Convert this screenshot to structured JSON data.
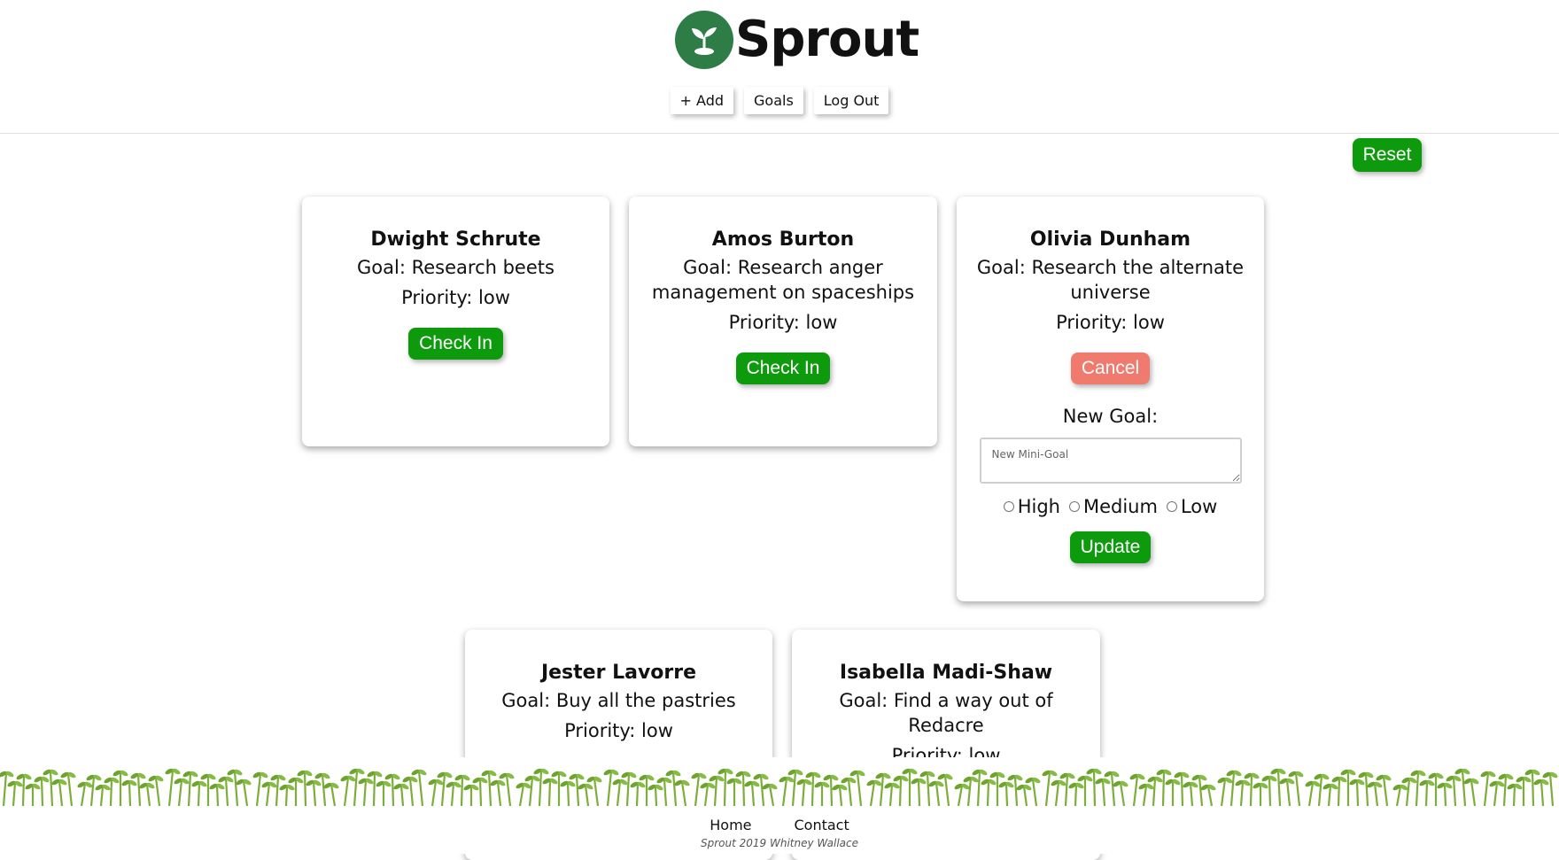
{
  "app": {
    "name": "Sprout",
    "logo_icon": "sprout-icon",
    "brand_color": "#2e7d46"
  },
  "nav": {
    "add_label": "+ Add",
    "goals_label": "Goals",
    "logout_label": "Log Out"
  },
  "reset_label": "Reset",
  "colors": {
    "accent_green": "#0d9b0d",
    "cancel_red": "#f07a6e"
  },
  "cards": [
    {
      "name": "Dwight Schrute",
      "goal": "Goal: Research beets",
      "priority": "Priority: low",
      "button": "Check In"
    },
    {
      "name": "Amos Burton",
      "goal": "Goal: Research anger management on spaceships",
      "priority": "Priority: low",
      "button": "Check In"
    },
    {
      "name": "Olivia Dunham",
      "goal": "Goal: Research the alternate universe",
      "priority": "Priority: low",
      "button": "Cancel",
      "form": {
        "label": "New Goal:",
        "placeholder": "New Mini-Goal",
        "options": [
          "High",
          "Medium",
          "Low"
        ],
        "submit": "Update"
      }
    },
    {
      "name": "Jester Lavorre",
      "goal": "Goal: Buy all the pastries",
      "priority": "Priority: low"
    },
    {
      "name": "Isabella Madi-Shaw",
      "goal": "Goal: Find a way out of Redacre",
      "priority": "Priority: low"
    }
  ],
  "footer": {
    "home_label": "Home",
    "contact_label": "Contact",
    "credit": "Sprout 2019 Whitney Wallace"
  }
}
